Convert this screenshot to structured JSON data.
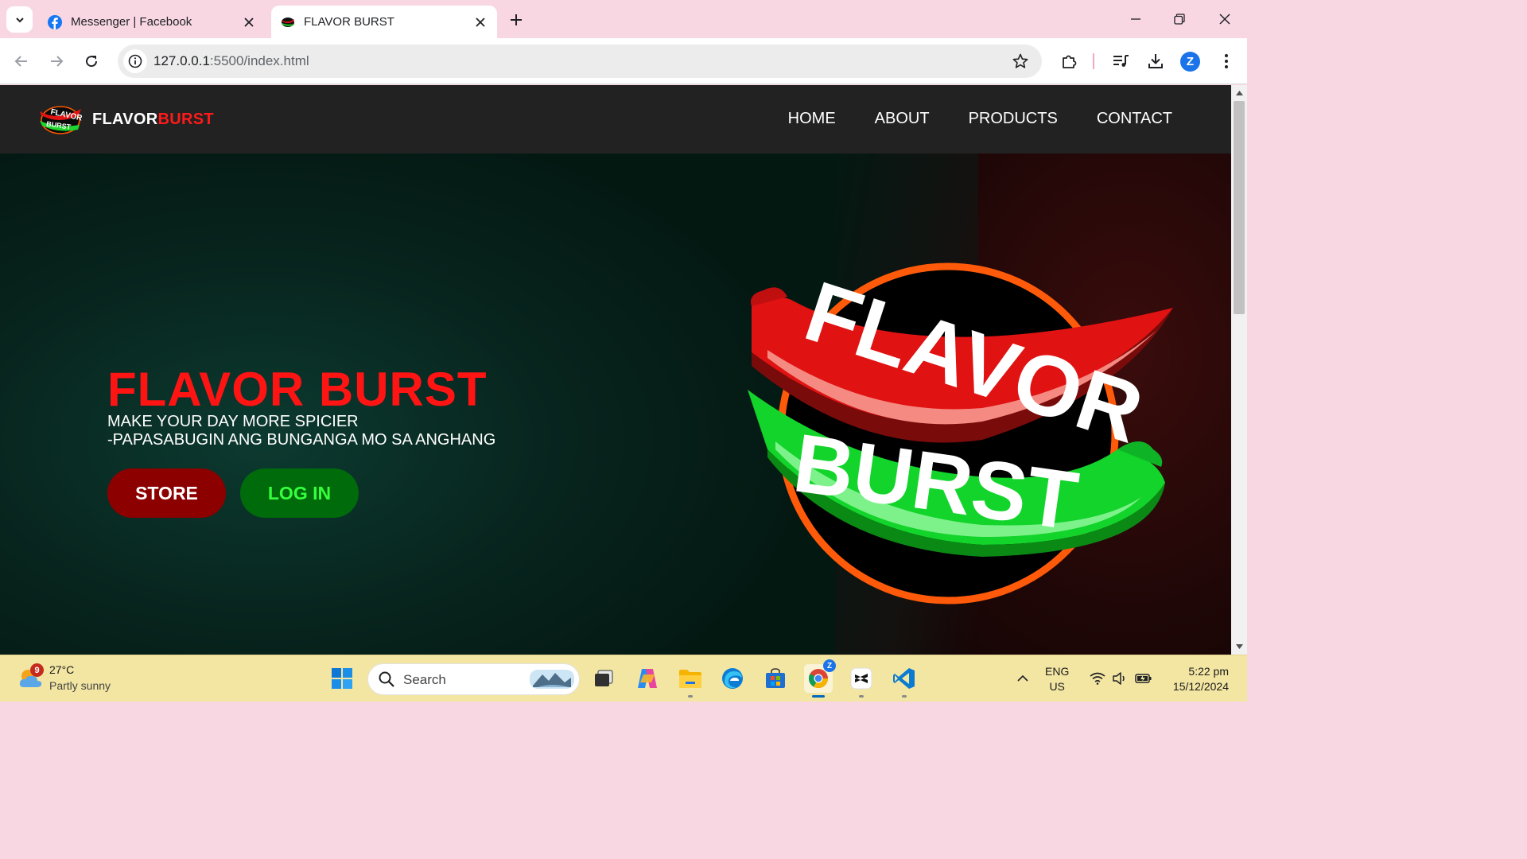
{
  "browser": {
    "tabs": [
      {
        "title": "Messenger | Facebook",
        "icon": "facebook-icon",
        "active": false
      },
      {
        "title": "FLAVOR BURST",
        "icon": "flavorburst-favicon",
        "active": true
      }
    ],
    "url_host": "127.0.0.1",
    "url_path": ":5500/index.html",
    "profile_initial": "Z"
  },
  "site": {
    "brand_white": "FLAVOR",
    "brand_red": "BURST",
    "nav": [
      "HOME",
      "ABOUT",
      "PRODUCTS",
      "CONTACT"
    ],
    "hero_title": "FLAVOR BURST",
    "tagline_1": "MAKE YOUR DAY MORE SPICIER",
    "tagline_2": "-PAPASABUGIN ANG BUNGANGA MO SA ANGHANG",
    "store_label": "STORE",
    "login_label": "LOG IN",
    "logo_word_top": "FLAVOR",
    "logo_word_bottom": "BURST"
  },
  "colors": {
    "accent_red": "#ff1414",
    "store_bg": "#8c0000",
    "login_bg": "#006b0a",
    "login_text": "#35ff3c",
    "navbar": "#222222"
  },
  "taskbar": {
    "weather_temp": "27°C",
    "weather_desc": "Partly sunny",
    "weather_badge": "9",
    "search_label": "Search",
    "lang_1": "ENG",
    "lang_2": "US",
    "time": "5:22 pm",
    "date": "15/12/2024",
    "chrome_badge": "Z"
  }
}
